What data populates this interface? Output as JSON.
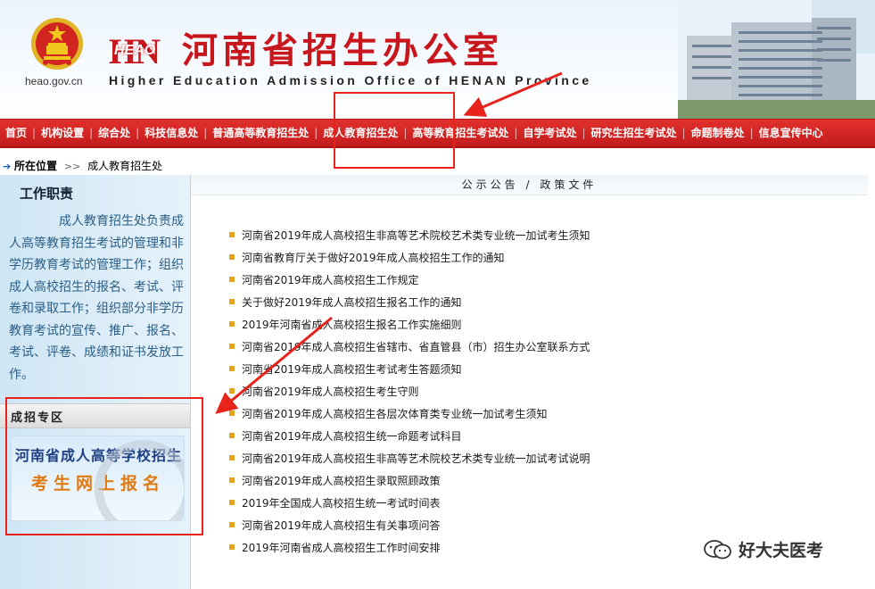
{
  "header": {
    "domain_text": "heao.gov.cn",
    "logo_mark": "HN",
    "logo_overlay": "HEAO",
    "title": "河南省招生办公室",
    "subtitle": "Higher Education Admission Office of HENAN Province"
  },
  "nav": {
    "items": [
      {
        "label": "首页"
      },
      {
        "label": "机构设置"
      },
      {
        "label": "综合处"
      },
      {
        "label": "科技信息处"
      },
      {
        "label": "普通高等教育招生处"
      },
      {
        "label": "成人教育招生处"
      },
      {
        "label": "高等教育招生考试处"
      },
      {
        "label": "自学考试处"
      },
      {
        "label": "研究生招生考试处"
      },
      {
        "label": "命题制卷处"
      },
      {
        "label": "信息宣传中心"
      }
    ],
    "active_index": 5
  },
  "breadcrumb": {
    "label": "所在位置",
    "separator": ">>",
    "current": "成人教育招生处"
  },
  "sidebar": {
    "duty_title": "工作职责",
    "duty_text": "成人教育招生处负责成人高等教育招生考试的管理和非学历教育考试的管理工作；组织成人高校招生的报名、考试、评卷和录取工作；组织部分非学历教育考试的宣传、推广、报名、考试、评卷、成绩和证书发放工作。",
    "zone_title": "成招专区",
    "banner_line1": "河南省成人高等学校招生",
    "banner_line2": "考生网上报名"
  },
  "main": {
    "section_title": "公示公告 / 政策文件",
    "news": [
      "河南省2019年成人高校招生非高等艺术院校艺术类专业统一加试考生须知",
      "河南省教育厅关于做好2019年成人高校招生工作的通知",
      "河南省2019年成人高校招生工作规定",
      "关于做好2019年成人高校招生报名工作的通知",
      "2019年河南省成人高校招生报名工作实施细则",
      "河南省2019年成人高校招生省辖市、省直管县（市）招生办公室联系方式",
      "河南省2019年成人高校招生考试考生答题须知",
      "河南省2019年成人高校招生考生守则",
      "河南省2019年成人高校招生各层次体育类专业统一加试考生须知",
      "河南省2019年成人高校招生统一命题考试科目",
      "河南省2019年成人高校招生非高等艺术院校艺术类专业统一加试考试说明",
      "河南省2019年成人高校招生录取照顾政策",
      "2019年全国成人高校招生统一考试时间表",
      "河南省2019年成人高校招生有关事项问答",
      "2019年河南省成人高校招生工作时间安排"
    ]
  },
  "watermark": {
    "text": "好大夫医考"
  },
  "colors": {
    "nav_red": "#d42522",
    "title_red": "#c8161d",
    "annotation_red": "#e8231c",
    "bullet": "#e5a21b",
    "sidebar_blue": "#cfe6f5"
  },
  "icons": [
    "national-emblem-icon",
    "arrow-right-icon",
    "bullet-square-icon",
    "wechat-icon"
  ]
}
